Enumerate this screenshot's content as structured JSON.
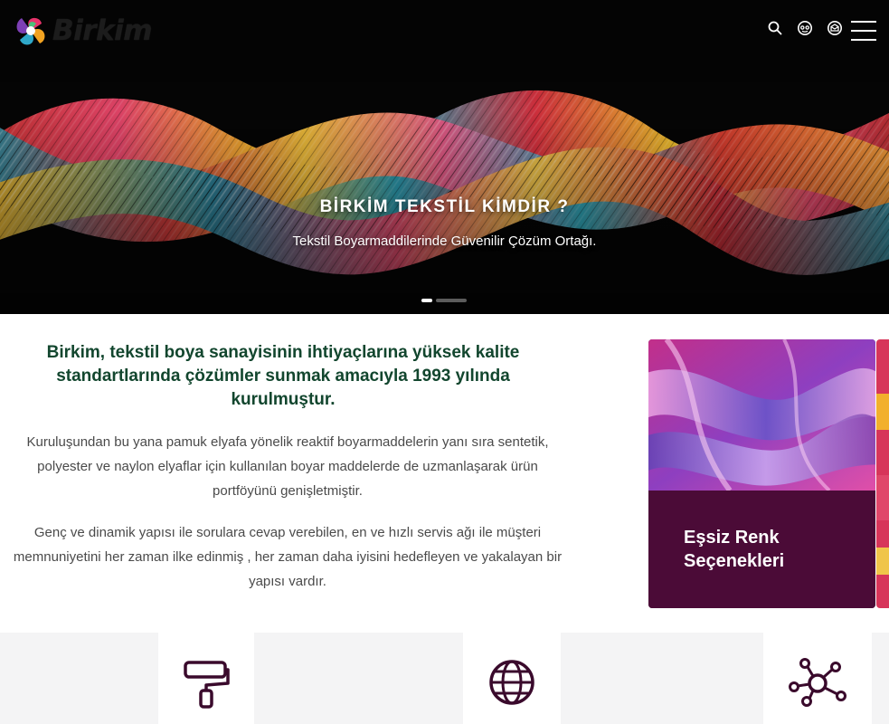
{
  "header": {
    "brand_name": "Birkim",
    "icons": [
      "search-icon",
      "support-icon",
      "mail-icon",
      "hamburger-menu-icon"
    ]
  },
  "hero": {
    "title": "BİRKİM TEKSTİL KİMDİR ?",
    "subtitle": "Tekstil Boyarmaddilerinde Güvenilir Çözüm Ortağı.",
    "slides_total": 2,
    "active_slide": 1
  },
  "about": {
    "heading": "Birkim, tekstil boya sanayisinin ihtiyaçlarına yüksek kalite standartlarında çözümler sunmak amacıyla 1993 yılında kurulmuştur.",
    "paragraph_1": "Kuruluşundan bu yana pamuk elyafa yönelik reaktif boyarmaddelerin yanı sıra sentetik, polyester ve naylon elyaflar için kullanılan boyar maddelerde de uzmanlaşarak ürün portföyünü genişletmiştir.",
    "paragraph_2": "Genç ve dinamik yapısı ile sorulara cevap verebilen, en ve hızlı servis ağı ile müşteri memnuniyetini her zaman ilke edinmiş , her zaman daha iyisini hedefleyen ve yakalayan bir yapısı vardır."
  },
  "feature_card": {
    "title": "Eşsiz Renk Seçenekleri"
  },
  "features": {
    "icons": [
      "paint-roller-icon",
      "globe-icon",
      "network-icon"
    ]
  },
  "colors": {
    "heading_green": "#12462e",
    "card_purple": "#4b0b37",
    "hero_bg": "#050505",
    "icon_dark": "#3a0a2c"
  }
}
